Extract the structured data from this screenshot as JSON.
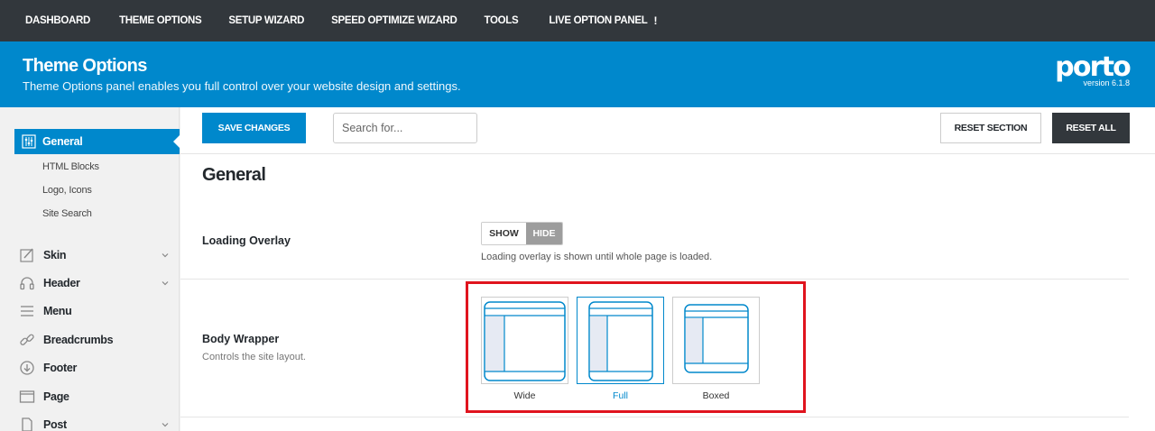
{
  "topnav": {
    "items": [
      "DASHBOARD",
      "THEME OPTIONS",
      "SETUP WIZARD",
      "SPEED OPTIMIZE WIZARD",
      "TOOLS",
      "LIVE OPTION PANEL"
    ],
    "warning": "!"
  },
  "header": {
    "title": "Theme Options",
    "subtitle": "Theme Options panel enables you full control over your website design and settings.",
    "brand": "porto",
    "version": "version 6.1.8"
  },
  "sidebar": {
    "active": "General",
    "subitems": [
      "HTML Blocks",
      "Logo, Icons",
      "Site Search"
    ],
    "items": [
      {
        "label": "Skin",
        "icon": "skin-icon",
        "expandable": true
      },
      {
        "label": "Header",
        "icon": "headphones-icon",
        "expandable": true
      },
      {
        "label": "Menu",
        "icon": "menu-icon",
        "expandable": false
      },
      {
        "label": "Breadcrumbs",
        "icon": "link-icon",
        "expandable": false
      },
      {
        "label": "Footer",
        "icon": "arrow-down-circle-icon",
        "expandable": false
      },
      {
        "label": "Page",
        "icon": "window-icon",
        "expandable": false
      },
      {
        "label": "Post",
        "icon": "document-icon",
        "expandable": true
      }
    ]
  },
  "toolbar": {
    "save_label": "SAVE CHANGES",
    "search_placeholder": "Search for...",
    "reset_section_label": "RESET SECTION",
    "reset_all_label": "RESET ALL"
  },
  "section": {
    "title": "General",
    "loading_overlay": {
      "label": "Loading Overlay",
      "options": [
        "SHOW",
        "HIDE"
      ],
      "selected": "HIDE",
      "description": "Loading overlay is shown until whole page is loaded."
    },
    "body_wrapper": {
      "label": "Body Wrapper",
      "sublabel": "Controls the site layout.",
      "options": [
        "Wide",
        "Full",
        "Boxed"
      ],
      "selected": "Full"
    }
  },
  "colors": {
    "brand_blue": "#0088cc",
    "admin_dark": "#32373c",
    "highlight_red": "#e0141e"
  }
}
